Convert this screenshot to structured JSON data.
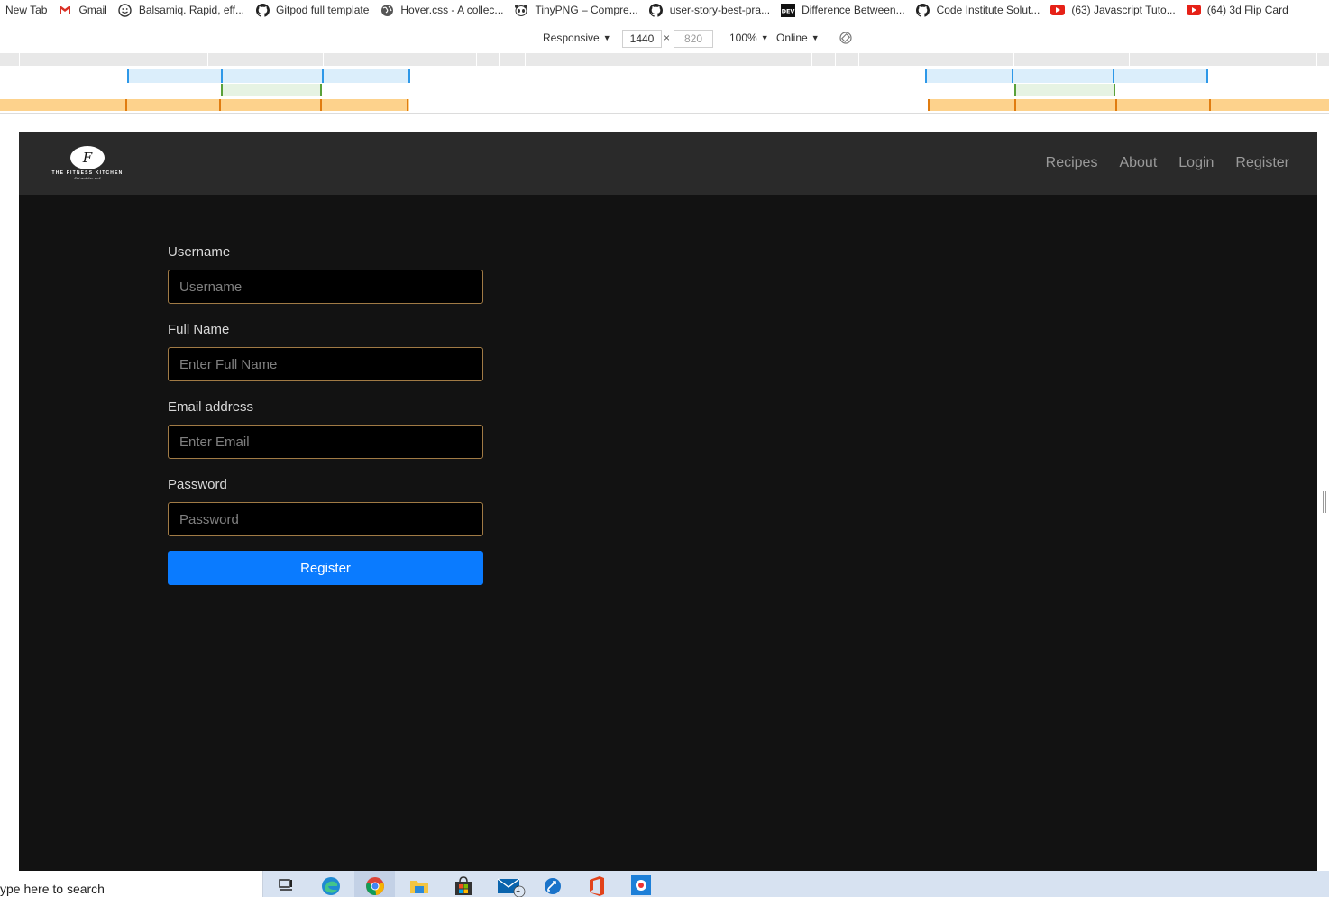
{
  "bookmarks": [
    {
      "label": "New Tab",
      "icon": "none"
    },
    {
      "label": "Gmail",
      "icon": "gmail-icon"
    },
    {
      "label": "Balsamiq. Rapid, eff...",
      "icon": "balsamiq-icon"
    },
    {
      "label": "Gitpod full template",
      "icon": "github-icon"
    },
    {
      "label": "Hover.css - A collec...",
      "icon": "globe-icon"
    },
    {
      "label": "TinyPNG – Compre...",
      "icon": "panda-icon"
    },
    {
      "label": "user-story-best-pra...",
      "icon": "github-icon"
    },
    {
      "label": "Difference Between...",
      "icon": "dev-icon"
    },
    {
      "label": "Code Institute Solut...",
      "icon": "github-icon"
    },
    {
      "label": "(63) Javascript Tuto...",
      "icon": "youtube-icon"
    },
    {
      "label": "(64) 3d Flip Card",
      "icon": "youtube-icon"
    }
  ],
  "devtools": {
    "device": "Responsive",
    "width": "1440",
    "height": "820",
    "dim_separator": "×",
    "zoom": "100%",
    "network": "Online",
    "caret": "▼"
  },
  "colors": {
    "mq_max_width": "#dbeefb",
    "mq_max_width_tick": "#2e98e8",
    "mq_min_max": "#e6f3e3",
    "mq_min_max_tick": "#5aa13a",
    "mq_min_width": "#fdd28c",
    "mq_min_width_tick": "#e07c10",
    "primary_button": "#0a7bff"
  },
  "site": {
    "logo": {
      "mark": "F",
      "brand": "THE FITNESS KITCHEN",
      "tagline": "Eat well live well"
    },
    "nav": [
      "Recipes",
      "About",
      "Login",
      "Register"
    ]
  },
  "form": {
    "username": {
      "label": "Username",
      "placeholder": "Username",
      "value": ""
    },
    "full_name": {
      "label": "Full Name",
      "placeholder": "Enter Full Name",
      "value": ""
    },
    "email": {
      "label": "Email address",
      "placeholder": "Enter Email",
      "value": ""
    },
    "password": {
      "label": "Password",
      "placeholder": "Password",
      "value": ""
    },
    "submit_label": "Register"
  },
  "taskbar": {
    "search_text": "ype here to search",
    "apps": [
      "task-view-icon",
      "edge-icon",
      "chrome-icon",
      "file-explorer-icon",
      "store-icon",
      "mail-icon",
      "remote-icon",
      "office-icon",
      "snip-icon"
    ],
    "mail_badge": "1"
  }
}
